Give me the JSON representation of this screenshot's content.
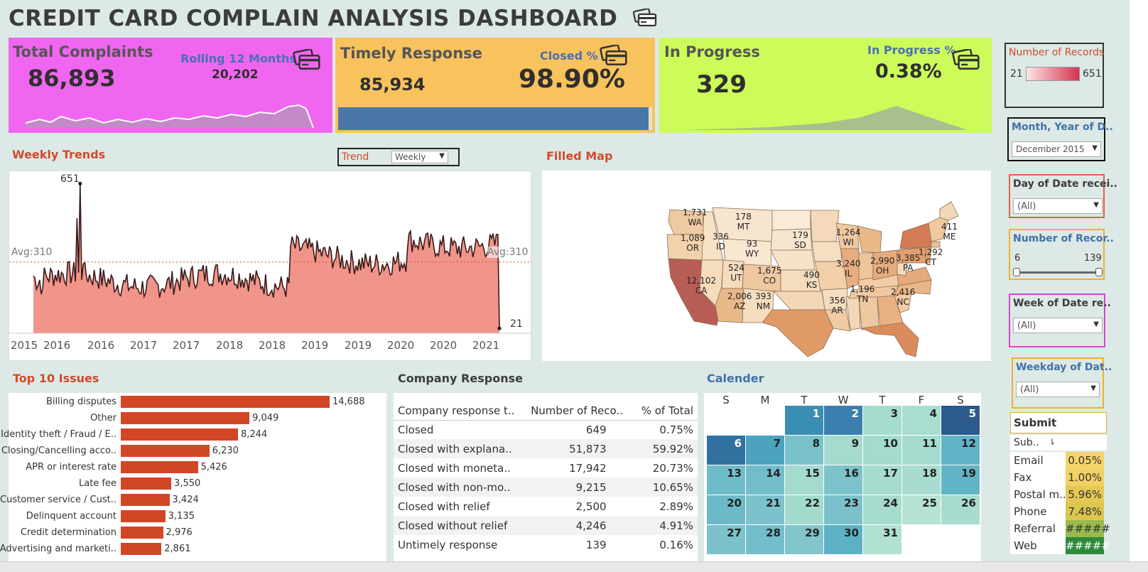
{
  "header": {
    "title": "CREDIT CARD COMPLAIN ANALYSIS DASHBOARD",
    "icon": "credit-card-icon"
  },
  "kpi": {
    "total": {
      "label": "Total Complaints",
      "value": "86,893",
      "rolling_label": "Rolling 12 Months",
      "rolling_value": "20,202",
      "color": "#f066f0"
    },
    "timely": {
      "label": "Timely Response",
      "value": "85,934",
      "closed_label": "Closed %",
      "closed_value": "98.90%",
      "color": "#f8c25d",
      "progress": 0.989
    },
    "progress": {
      "label": "In Progress",
      "value": "329",
      "pct_label": "In Progress %",
      "pct_value": "0.38%",
      "color": "#cdfb5a"
    }
  },
  "weekly": {
    "title": "Weekly Trends",
    "trend_label": "Trend",
    "trend_value": "Weekly",
    "max_label": "651",
    "min_label": "21",
    "avg_left": "Avg:310",
    "avg_right": "Avg:310",
    "xticks": [
      "2015",
      "2016",
      "2016",
      "2017",
      "2017",
      "2018",
      "2018",
      "2019",
      "2019",
      "2020",
      "2020",
      "2021"
    ]
  },
  "map": {
    "title": "Filled Map",
    "states": [
      {
        "code": "WA",
        "value": "1,731"
      },
      {
        "code": "OR",
        "value": "1,089"
      },
      {
        "code": "ID",
        "value": "336"
      },
      {
        "code": "MT",
        "value": "178"
      },
      {
        "code": "WY",
        "value": "93"
      },
      {
        "code": "SD",
        "value": "179"
      },
      {
        "code": "CA",
        "value": "12,102"
      },
      {
        "code": "UT",
        "value": "524"
      },
      {
        "code": "CO",
        "value": "1,675"
      },
      {
        "code": "KS",
        "value": "490"
      },
      {
        "code": "AZ",
        "value": "2,006"
      },
      {
        "code": "NM",
        "value": "393"
      },
      {
        "code": "AR",
        "value": "356"
      },
      {
        "code": "WI",
        "value": "1,264"
      },
      {
        "code": "IL",
        "value": "3,240"
      },
      {
        "code": "TN",
        "value": "1,196"
      },
      {
        "code": "OH",
        "value": "2,990"
      },
      {
        "code": "PA",
        "value": "3,385"
      },
      {
        "code": "CT",
        "value": "1,292"
      },
      {
        "code": "ME",
        "value": "411"
      },
      {
        "code": "NC",
        "value": "2,416"
      }
    ]
  },
  "issues": {
    "title": "Top 10 Issues",
    "items": [
      {
        "label": "Billing disputes",
        "value": 14688,
        "display": "14,688"
      },
      {
        "label": "Other",
        "value": 9049,
        "display": "9,049"
      },
      {
        "label": "Identity theft / Fraud / E..",
        "value": 8244,
        "display": "8,244"
      },
      {
        "label": "Closing/Cancelling acco..",
        "value": 6230,
        "display": "6,230"
      },
      {
        "label": "APR or interest rate",
        "value": 5426,
        "display": "5,426"
      },
      {
        "label": "Late fee",
        "value": 3550,
        "display": "3,550"
      },
      {
        "label": "Customer service / Cust..",
        "value": 3424,
        "display": "3,424"
      },
      {
        "label": "Delinquent account",
        "value": 3135,
        "display": "3,135"
      },
      {
        "label": "Credit determination",
        "value": 2976,
        "display": "2,976"
      },
      {
        "label": "Advertising and marketi..",
        "value": 2861,
        "display": "2,861"
      }
    ]
  },
  "company_response": {
    "title": "Company Response",
    "headers": [
      "Company response t..",
      "Number of Reco..",
      "% of Total"
    ],
    "rows": [
      [
        "Closed",
        "649",
        "0.75%"
      ],
      [
        "Closed with explana..",
        "51,873",
        "59.92%"
      ],
      [
        "Closed with moneta..",
        "17,942",
        "20.73%"
      ],
      [
        "Closed with non-mo..",
        "9,215",
        "10.65%"
      ],
      [
        "Closed with relief",
        "2,500",
        "2.89%"
      ],
      [
        "Closed without relief",
        "4,246",
        "4.91%"
      ],
      [
        "Untimely response",
        "139",
        "0.16%"
      ]
    ]
  },
  "calendar": {
    "title": "Calender",
    "weekdays": [
      "S",
      "M",
      "T",
      "W",
      "T",
      "F",
      "S"
    ],
    "days": [
      {
        "d": "1",
        "c": "#3a8db3"
      },
      {
        "d": "2",
        "c": "#3a7fae"
      },
      {
        "d": "3",
        "c": "#a6dccf"
      },
      {
        "d": "4",
        "c": "#a9ddd0"
      },
      {
        "d": "5",
        "c": "#2b5a8c"
      },
      {
        "d": "6",
        "c": "#31719f"
      },
      {
        "d": "7",
        "c": "#4ca3be"
      },
      {
        "d": "8",
        "c": "#7ac1cb"
      },
      {
        "d": "9",
        "c": "#a5dacf"
      },
      {
        "d": "10",
        "c": "#a4dbcf"
      },
      {
        "d": "11",
        "c": "#a6dccf"
      },
      {
        "d": "12",
        "c": "#61b3c6"
      },
      {
        "d": "13",
        "c": "#6fbcc9"
      },
      {
        "d": "14",
        "c": "#73bdca"
      },
      {
        "d": "15",
        "c": "#a4dbcf"
      },
      {
        "d": "16",
        "c": "#7dc3cb"
      },
      {
        "d": "17",
        "c": "#a6dccf"
      },
      {
        "d": "18",
        "c": "#a8dcd0"
      },
      {
        "d": "19",
        "c": "#62b4c6"
      },
      {
        "d": "20",
        "c": "#6cbac8"
      },
      {
        "d": "21",
        "c": "#7cc2cb"
      },
      {
        "d": "22",
        "c": "#a3dace"
      },
      {
        "d": "23",
        "c": "#7bc1cb"
      },
      {
        "d": "24",
        "c": "#a6dccf"
      },
      {
        "d": "25",
        "c": "#b7e3d4"
      },
      {
        "d": "26",
        "c": "#a7dccf"
      },
      {
        "d": "27",
        "c": "#7cc2cb"
      },
      {
        "d": "28",
        "c": "#74bdca"
      },
      {
        "d": "29",
        "c": "#82c5cc"
      },
      {
        "d": "30",
        "c": "#5eb1c5"
      },
      {
        "d": "31",
        "c": "#b1e1d3"
      }
    ]
  },
  "filters": {
    "records_legend": {
      "title": "Number of Records",
      "min": "21",
      "max": "651"
    },
    "month_year": {
      "title": "Month, Year of D..",
      "value": "December 2015"
    },
    "day_of_date": {
      "title": "Day of Date recei..",
      "value": "(All)"
    },
    "num_records": {
      "title": "Number of Recor..",
      "min": "6",
      "max": "139"
    },
    "week_of_date": {
      "title": "Week of Date re..",
      "value": "(All)"
    },
    "weekday_of_date": {
      "title": "Weekday of Dat..",
      "value": "(All)"
    }
  },
  "submit": {
    "title": "Submit",
    "col_header": "Sub..",
    "rows": [
      {
        "label": "Email",
        "value": "0.05%",
        "color": "#f4d36a"
      },
      {
        "label": "Fax",
        "value": "1.00%",
        "color": "#f1d064"
      },
      {
        "label": "Postal m..",
        "value": "5.96%",
        "color": "#e3c954"
      },
      {
        "label": "Phone",
        "value": "7.48%",
        "color": "#dcc650"
      },
      {
        "label": "Referral",
        "value": "#####",
        "color": "#99ba4e"
      },
      {
        "label": "Web",
        "value": "#####",
        "color": "#2d8a3a"
      }
    ]
  }
}
